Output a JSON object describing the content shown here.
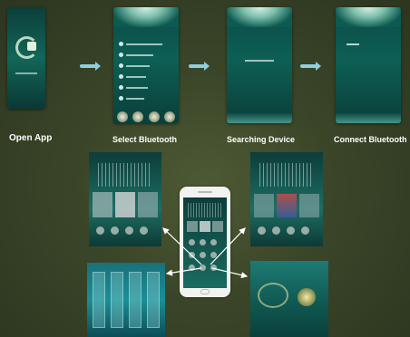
{
  "steps": [
    {
      "label": "Open  App"
    },
    {
      "label": "Select Bluetooth"
    },
    {
      "label": "Searching Device"
    },
    {
      "label": "Connect Bluetooth"
    }
  ],
  "colors": {
    "accent": "#8ecfe0",
    "teal": "#0d5f55"
  }
}
